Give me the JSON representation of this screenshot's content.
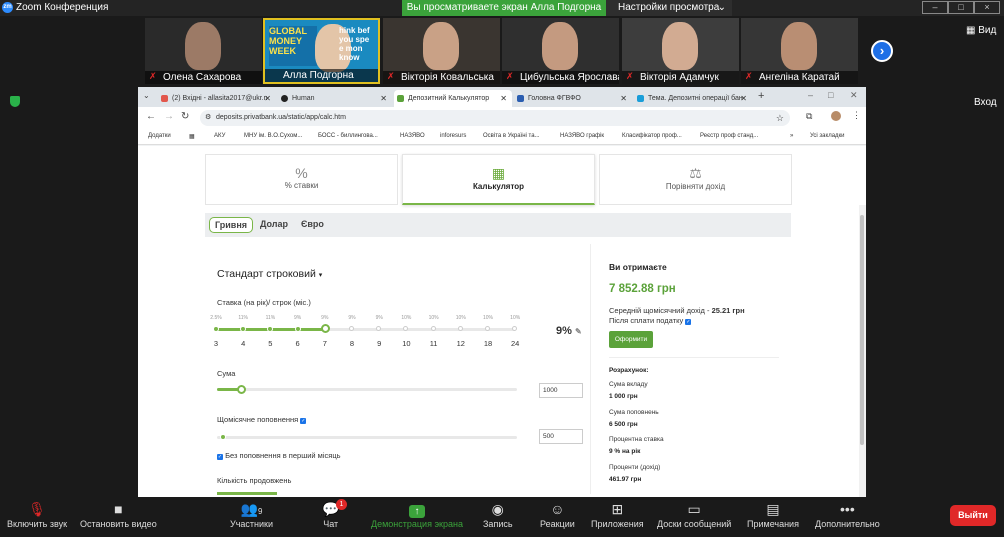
{
  "zoom": {
    "title": "Zoom Конференция",
    "banner": "Вы просматриваете экран Алла Подгорна",
    "view_settings": "Настройки просмотра",
    "view_label": "Вид",
    "enter_label": "Вход",
    "participants": [
      {
        "name": "Олена Сахарова"
      },
      {
        "name": "Алла Подгорна"
      },
      {
        "name": "Вікторія Ковальська"
      },
      {
        "name": "Цибульська Ярослава"
      },
      {
        "name": "Вікторія Адамчук"
      },
      {
        "name": "Ангеліна Каратай"
      }
    ],
    "toolbar": {
      "audio": "Включить звук",
      "video": "Остановить видео",
      "participants": "Участники",
      "participants_count": "9",
      "chat": "Чат",
      "chat_badge": "1",
      "share": "Демонстрация экрана",
      "record": "Запись",
      "reactions": "Реакции",
      "apps": "Приложения",
      "whiteboards": "Доски сообщений",
      "notes": "Примечания",
      "more": "Дополнительно",
      "leave": "Выйти"
    }
  },
  "browser": {
    "tabs": [
      "(2) Вхідні - allasita2017@ukr.n",
      "Human",
      "Депозитний Калькулятор",
      "Головна ФГВФО",
      "Тема. Депозитні операції бан"
    ],
    "url": "deposits.privatbank.ua/static/app/calc.htm",
    "bookmarks": [
      "Додатки",
      "АКУ",
      "МНУ ім. В.О.Сухом...",
      "БОСС - биллингова...",
      "НАЗЯВО",
      "inforesurs",
      "Освіта в Україні та...",
      "НАЗЯВО графік",
      "Класифікатор проф...",
      "Реєстр проф станд..."
    ],
    "all_bookmarks": "Усі закладки"
  },
  "calc": {
    "nav": [
      "% ставки",
      "Калькулятор",
      "Порівняти дохід"
    ],
    "currencies": [
      "Гривня",
      "Долар",
      "Євро"
    ],
    "deposit_type": "Стандарт строковий",
    "rate_label": "Ставка (на рік)/ строк (міс.)",
    "rate_top": [
      "2.5%",
      "11%",
      "11%",
      "9%",
      "9%",
      "9%",
      "9%",
      "10%",
      "10%",
      "10%",
      "10%",
      "10%"
    ],
    "terms": [
      "3",
      "4",
      "5",
      "6",
      "7",
      "8",
      "9",
      "10",
      "11",
      "12",
      "18",
      "24"
    ],
    "selected_rate": "9%",
    "sum_label": "Сума",
    "sum_value": "1000",
    "monthly_label": "Щомісячне поповнення",
    "monthly_value": "500",
    "no_first_month": "Без поповнення в перший місяць",
    "prolong_label": "Кількість продовжень",
    "result": {
      "title": "Ви отримаєте",
      "amount": "7 852.88 грн",
      "avg_label": "Середній щомісячний дохід -",
      "avg_value": "25.21 грн",
      "after_tax": "Після сплати податку",
      "button": "Оформити",
      "calc_title": "Розрахунок:",
      "rows": [
        {
          "label": "Сума вкладу",
          "value": "1 000 грн"
        },
        {
          "label": "Сума поповнень",
          "value": "6 500 грн"
        },
        {
          "label": "Процентна ставка",
          "value": "9 % на рік"
        },
        {
          "label": "Проценти (дохід)",
          "value": "461.97 грн"
        }
      ]
    }
  }
}
